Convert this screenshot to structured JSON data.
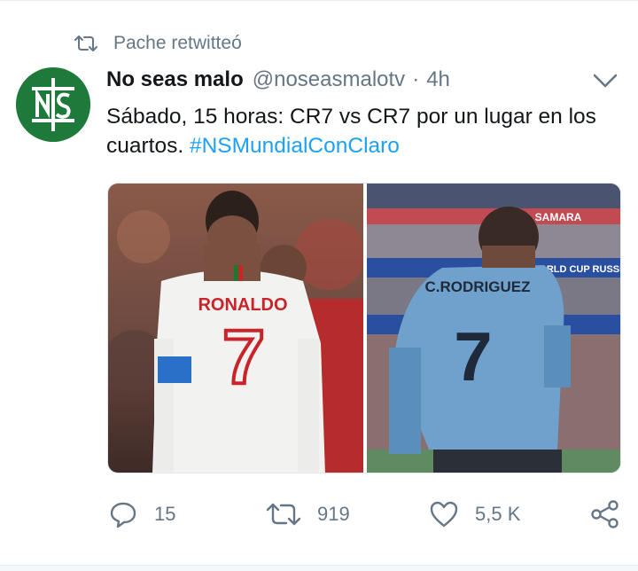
{
  "retweet_context": {
    "icon": "retweet-icon",
    "text": "Pache retwitteó"
  },
  "tweet": {
    "author_name": "No seas malo",
    "handle": "@noseasmalotv",
    "separator": "·",
    "time": "4h",
    "text_main": "Sábado, 15 horas: CR7 vs CR7 por un lugar en los cuartos. ",
    "hashtag": "#NSMundialConClaro",
    "avatar": {
      "icon": "ns-logo-icon",
      "bg_color": "#1e7a3a"
    },
    "images": [
      {
        "name": "photo-ronaldo",
        "jersey_name": "RONALDO",
        "number": "7"
      },
      {
        "name": "photo-crodriguez",
        "jersey_name": "C.RODRIGUEZ",
        "number": "7",
        "banner": "SAMARA",
        "board": "WORLD CUP RUSSIA"
      }
    ]
  },
  "actions": {
    "reply_count": "15",
    "retweet_count": "919",
    "like_count": "5,5 K"
  },
  "colors": {
    "link": "#1da1f2",
    "muted": "#657786",
    "text": "#14171a"
  }
}
